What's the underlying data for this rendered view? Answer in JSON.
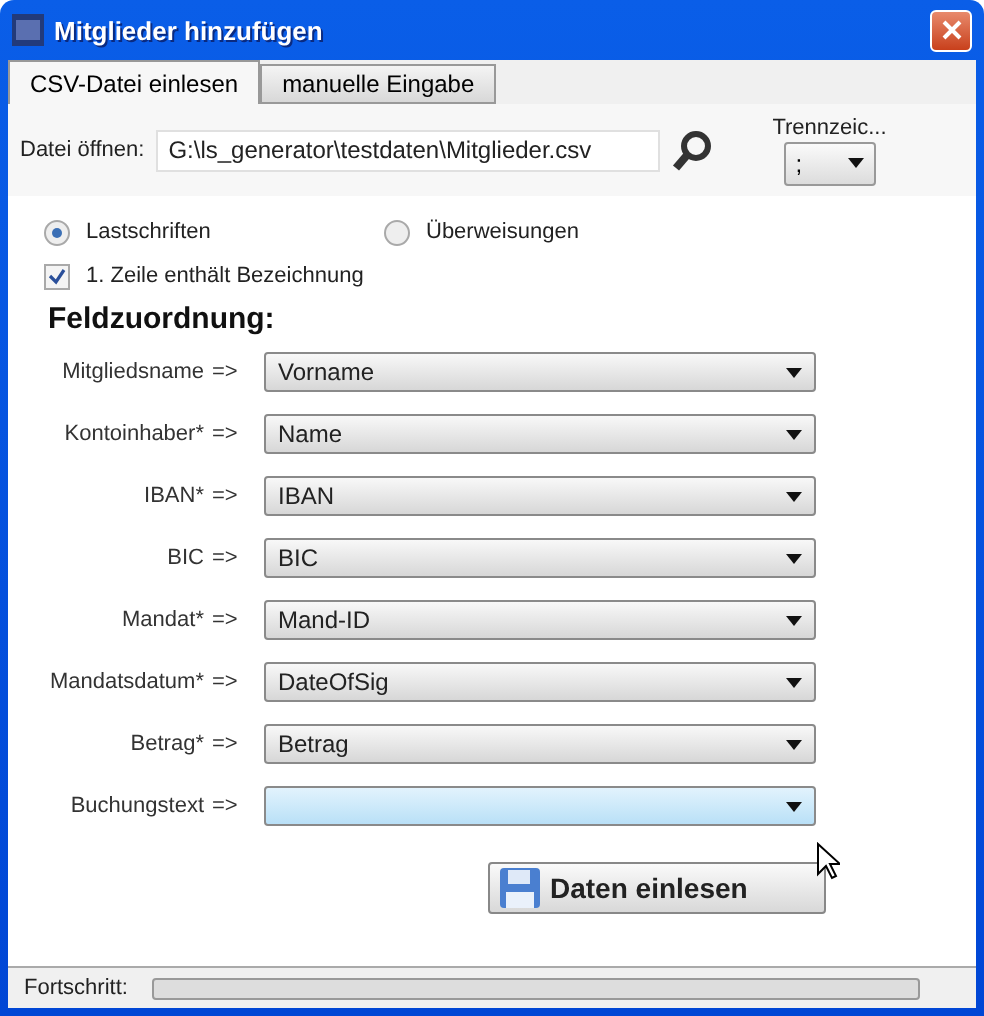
{
  "window": {
    "title": "Mitglieder hinzufügen"
  },
  "tabs": [
    {
      "label": "CSV-Datei einlesen",
      "selected": true
    },
    {
      "label": "manuelle Eingabe",
      "selected": false
    }
  ],
  "file": {
    "label": "Datei öffnen:",
    "value": "G:\\ls_generator\\testdaten\\Mitglieder.csv"
  },
  "separator": {
    "label": "Trennzeic...",
    "value": ";"
  },
  "radios": [
    {
      "label": "Lastschriften",
      "selected": true
    },
    {
      "label": "Überweisungen",
      "selected": false
    }
  ],
  "header_checkbox": {
    "label": "1. Zeile enthält Bezeichnung",
    "checked": true
  },
  "heading": "Feldzuordnung:",
  "mappings": [
    {
      "label": "Mitgliedsname",
      "arrow": "=>",
      "value": "Vorname",
      "hovered": false
    },
    {
      "label": "Kontoinhaber*",
      "arrow": "=>",
      "value": "Name",
      "hovered": false
    },
    {
      "label": "IBAN*",
      "arrow": "=>",
      "value": "IBAN",
      "hovered": false
    },
    {
      "label": "BIC",
      "arrow": "=>",
      "value": "BIC",
      "hovered": false
    },
    {
      "label": "Mandat*",
      "arrow": "=>",
      "value": "Mand-ID",
      "hovered": false
    },
    {
      "label": "Mandatsdatum*",
      "arrow": "=>",
      "value": "DateOfSig",
      "hovered": false
    },
    {
      "label": "Betrag*",
      "arrow": "=>",
      "value": "Betrag",
      "hovered": false
    },
    {
      "label": "Buchungstext",
      "arrow": "=>",
      "hovered": true
    }
  ],
  "submit": {
    "label": "Daten einlesen"
  },
  "status_bar": {
    "label": "Fortschritt:",
    "level": 0
  }
}
